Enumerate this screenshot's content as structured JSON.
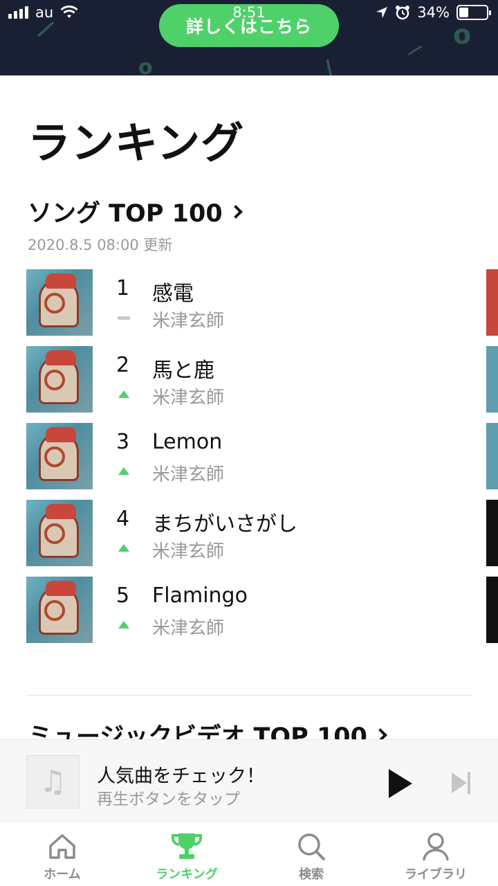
{
  "status_bar": {
    "carrier": "au",
    "time": "8:51",
    "battery_percent": "34%",
    "battery_level": 0.34
  },
  "banner": {
    "cta_label": "詳しくはこちら"
  },
  "page": {
    "title": "ランキング"
  },
  "song_ranking": {
    "title": "ソング TOP 100",
    "updated": "2020.8.5 08:00 更新",
    "items": [
      {
        "rank": "1",
        "title": "感電",
        "artist": "米津玄師",
        "trend": "same"
      },
      {
        "rank": "2",
        "title": "馬と鹿",
        "artist": "米津玄師",
        "trend": "up"
      },
      {
        "rank": "3",
        "title": "Lemon",
        "artist": "米津玄師",
        "trend": "up"
      },
      {
        "rank": "4",
        "title": "まちがいさがし",
        "artist": "米津玄師",
        "trend": "up"
      },
      {
        "rank": "5",
        "title": "Flamingo",
        "artist": "米津玄師",
        "trend": "up"
      }
    ]
  },
  "mv_ranking": {
    "title": "ミュージックビデオ TOP 100"
  },
  "mini_player": {
    "title": "人気曲をチェック！",
    "subtitle": "再生ボタンをタップ"
  },
  "tabs": [
    {
      "label": "ホーム",
      "icon": "home-icon",
      "active": false
    },
    {
      "label": "ランキング",
      "icon": "trophy-icon",
      "active": true
    },
    {
      "label": "検索",
      "icon": "search-icon",
      "active": false
    },
    {
      "label": "ライブラリ",
      "icon": "person-icon",
      "active": false
    }
  ],
  "colors": {
    "accent": "#4fd16a",
    "banner_bg": "#1a2033",
    "secondary_text": "#9a9a9a"
  }
}
